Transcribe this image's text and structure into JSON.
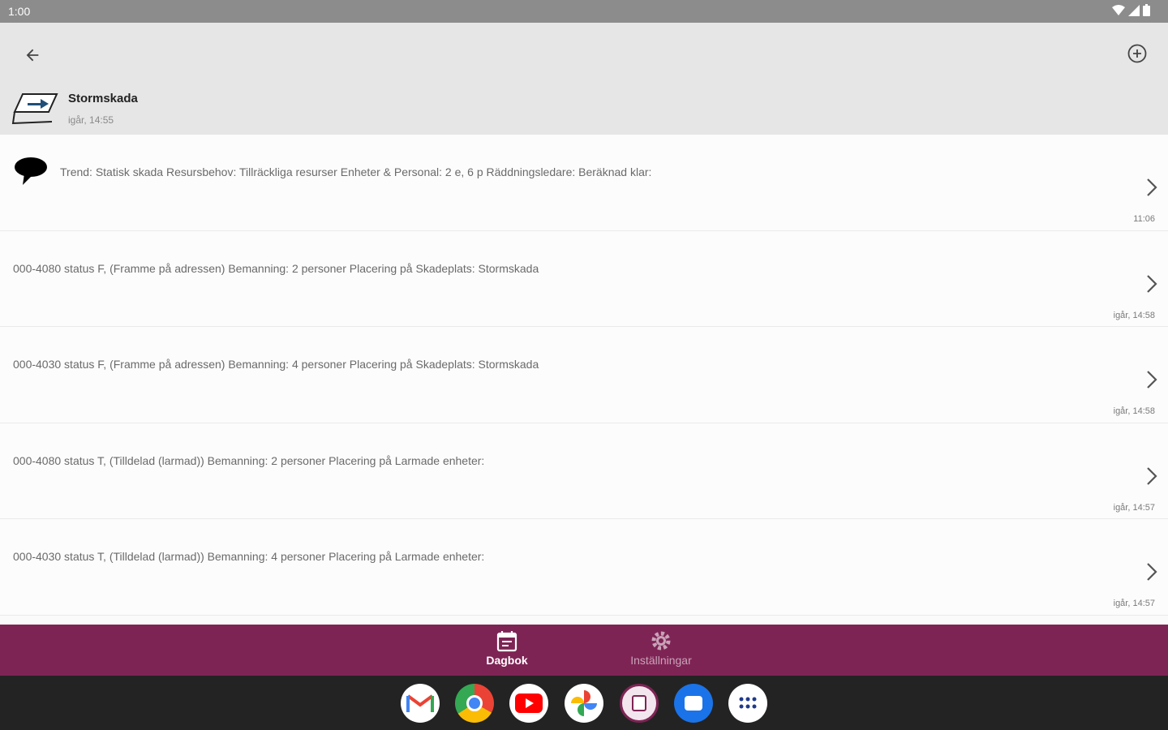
{
  "status_bar": {
    "time": "1:00"
  },
  "header": {
    "incident_title": "Stormskada",
    "incident_time": "igår, 14:55"
  },
  "entries": [
    {
      "text": "Trend: Statisk skada Resursbehov: Tillräckliga resurser Enheter & Personal: 2 e, 6 p Räddningsledare:  Beräknad klar:",
      "time": "11:06",
      "has_bubble": true
    },
    {
      "text": "000-4080 status F, (Framme på adressen) Bemanning: 2 personer Placering på Skadeplats: Stormskada",
      "time": "igår, 14:58"
    },
    {
      "text": "000-4030 status F, (Framme på adressen) Bemanning: 4 personer Placering på Skadeplats: Stormskada",
      "time": "igår, 14:58"
    },
    {
      "text": "000-4080 status T, (Tilldelad (larmad)) Bemanning: 2 personer Placering på Larmade enheter:",
      "time": "igår, 14:57"
    },
    {
      "text": "000-4030 status T, (Tilldelad (larmad)) Bemanning: 4 personer Placering på Larmade enheter:",
      "time": "igår, 14:57"
    }
  ],
  "bottom_nav": {
    "dagbok": "Dagbok",
    "installningar": "Inställningar"
  },
  "colors": {
    "nav_bg": "#7e2455",
    "header_bg": "#e6e6e6",
    "status_bg": "#8c8c8c"
  },
  "dock_apps": [
    "gmail-icon",
    "chrome-icon",
    "youtube-icon",
    "photos-icon",
    "app-icon",
    "messages-icon",
    "app-drawer-icon"
  ]
}
